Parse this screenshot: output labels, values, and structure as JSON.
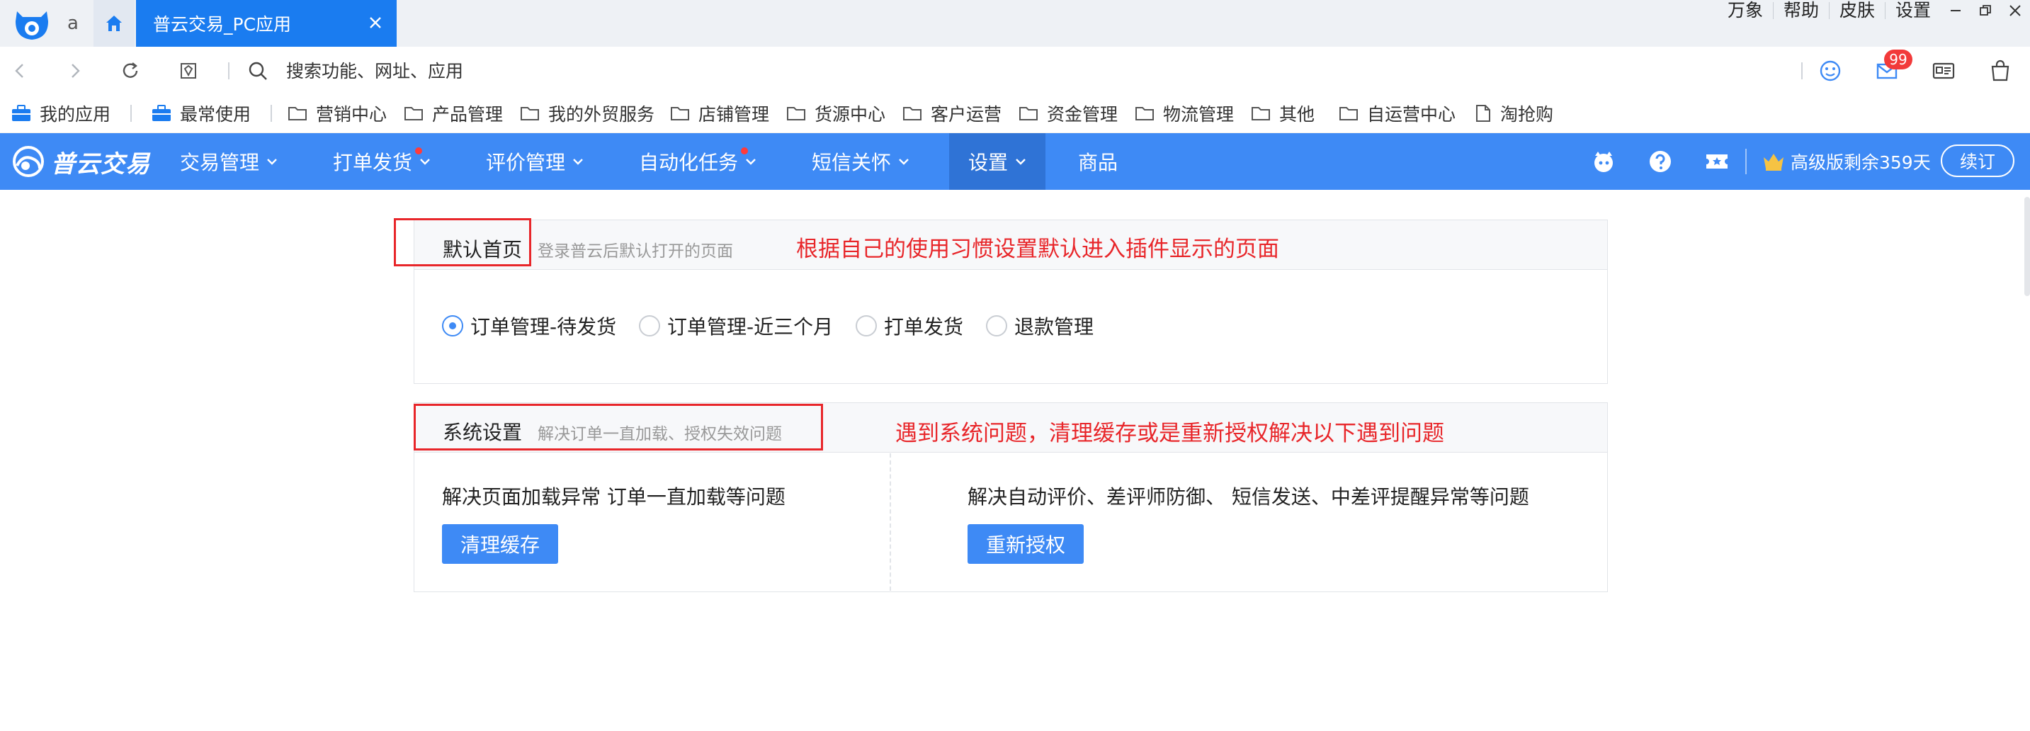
{
  "titlebar": {
    "tab_a_label": "a",
    "active_tab_label": "普云交易_PC应用",
    "links": [
      "万象",
      "帮助",
      "皮肤",
      "设置"
    ]
  },
  "addressbar": {
    "search_placeholder": "搜索功能、网址、应用",
    "mail_badge": "99"
  },
  "bookmarks": [
    {
      "label": "我的应用",
      "icon": "briefcase-icon"
    },
    {
      "label": "最常使用",
      "icon": "briefcase-icon"
    },
    {
      "label": "营销中心",
      "icon": "folder-icon"
    },
    {
      "label": "产品管理",
      "icon": "folder-icon"
    },
    {
      "label": "我的外贸服务",
      "icon": "folder-icon"
    },
    {
      "label": "店铺管理",
      "icon": "folder-icon"
    },
    {
      "label": "货源中心",
      "icon": "folder-icon"
    },
    {
      "label": "客户运营",
      "icon": "folder-icon"
    },
    {
      "label": "资金管理",
      "icon": "folder-icon"
    },
    {
      "label": "物流管理",
      "icon": "folder-icon"
    },
    {
      "label": "其他",
      "icon": "folder-icon"
    },
    {
      "label": "自运营中心",
      "icon": "folder-icon"
    },
    {
      "label": "淘抢购",
      "icon": "document-icon"
    }
  ],
  "navbar": {
    "brand": "普云交易",
    "items": [
      {
        "label": "交易管理"
      },
      {
        "label": "打单发货"
      },
      {
        "label": "评价管理"
      },
      {
        "label": "自动化任务"
      },
      {
        "label": "短信关怀"
      },
      {
        "label": "设置"
      },
      {
        "label": "商品"
      }
    ],
    "vip_text": "高级版剩余359天",
    "renew_label": "续订"
  },
  "default_home": {
    "title": "默认首页",
    "subtitle": "登录普云后默认打开的页面",
    "annotation": "根据自己的使用习惯设置默认进入插件显示的页面",
    "options": [
      "订单管理-待发货",
      "订单管理-近三个月",
      "打单发货",
      "退款管理"
    ],
    "selected": "订单管理-待发货"
  },
  "system_settings": {
    "title": "系统设置",
    "subtitle": "解决订单一直加载、授权失效问题",
    "annotation": "遇到系统问题，清理缓存或是重新授权解决以下遇到问题",
    "left_desc": "解决页面加载异常 订单一直加载等问题",
    "left_button": "清理缓存",
    "right_desc": "解决自动评价、差评师防御、 短信发送、中差评提醒异常等问题",
    "right_button": "重新授权"
  },
  "colors": {
    "accent": "#3e8af5",
    "tab_active": "#1a7cf0",
    "annotation_red": "#e8262a"
  }
}
